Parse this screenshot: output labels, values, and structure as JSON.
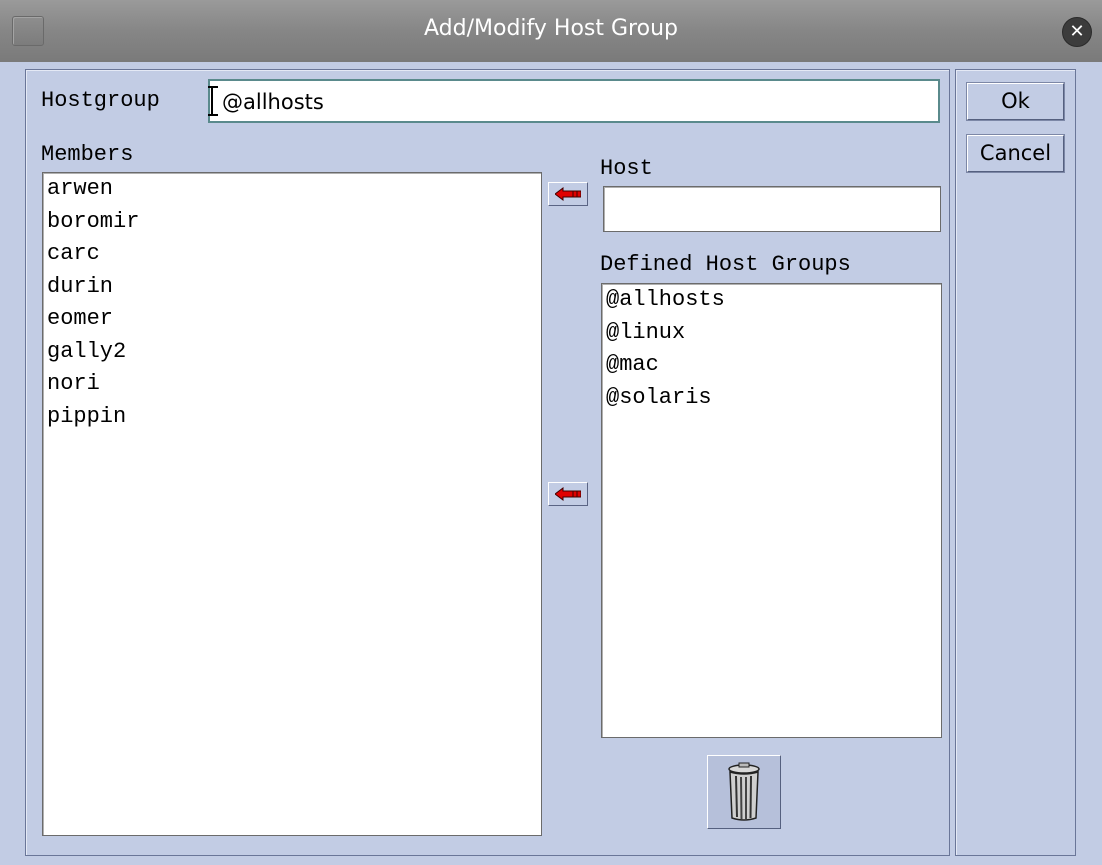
{
  "window": {
    "title": "Add/Modify Host Group"
  },
  "hostgroup": {
    "label": "Hostgroup",
    "value": "@allhosts"
  },
  "members": {
    "label": "Members",
    "items": [
      "arwen",
      "boromir",
      "carc",
      "durin",
      "eomer",
      "gally2",
      "nori",
      "pippin"
    ]
  },
  "host": {
    "label": "Host",
    "value": ""
  },
  "defined_groups": {
    "label": "Defined Host Groups",
    "items": [
      "@allhosts",
      "@linux",
      "@mac",
      "@solaris"
    ]
  },
  "buttons": {
    "ok": "Ok",
    "cancel": "Cancel"
  },
  "icons": {
    "menu": "window-menu-icon",
    "close": "close-icon",
    "arrow": "left-arrow-icon",
    "trash": "trash-icon"
  },
  "colors": {
    "background": "#c2cce4",
    "titlebar": "#868686",
    "arrow": "#e00000",
    "focus_border": "#5a8a8c"
  }
}
